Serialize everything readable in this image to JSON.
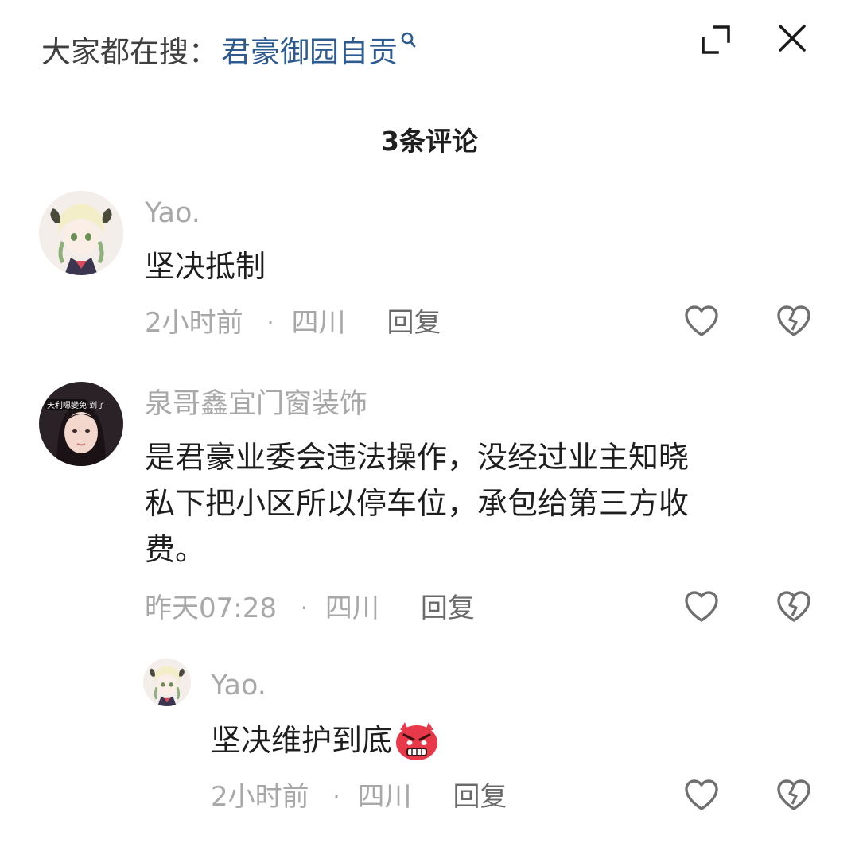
{
  "header": {
    "search_prefix": "大家都在搜：",
    "search_term": "君豪御园自贡",
    "search_icon": "search-icon",
    "expand_icon": "expand-icon",
    "close_icon": "close-icon",
    "link_color": "#2e5b8f"
  },
  "comments_title": "3条评论",
  "comments": [
    {
      "username": "Yao.",
      "text": "坚决抵制",
      "time": "2小时前",
      "separator": "·",
      "location": "四川",
      "reply_label": "回复"
    },
    {
      "username": "泉哥鑫宜门窗装饰",
      "text_lines": [
        "是君豪业委会违法操作，没经过业主知晓",
        "私下把小区所以停车位，承包给第三方收",
        "费。"
      ],
      "time": "昨天07:28",
      "separator": "·",
      "location": "四川",
      "reply_label": "回复",
      "avatar_overlay_text": "天利嗯變免  到了"
    },
    {
      "username": "Yao.",
      "text": "坚决维护到底",
      "emoji": "angry-face-emoji",
      "time": "2小时前",
      "separator": "·",
      "location": "四川",
      "reply_label": "回复"
    }
  ],
  "colors": {
    "meta_gray": "#a8a8a8",
    "text_dark": "#1e1e1e",
    "emoji_red": "#e8394a"
  }
}
